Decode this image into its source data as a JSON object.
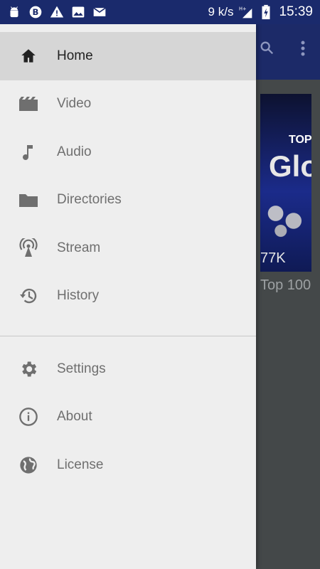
{
  "statusbar": {
    "speed": "9 k/s",
    "network": "H+",
    "time": "15:39"
  },
  "background": {
    "card_banner_small": "TOP",
    "card_banner_big": "Glo",
    "card_views": "77K",
    "card_title": "Top 100"
  },
  "drawer": {
    "items": [
      {
        "label": "Home",
        "icon": "home-icon",
        "selected": true
      },
      {
        "label": "Video",
        "icon": "movie-icon"
      },
      {
        "label": "Audio",
        "icon": "music-note-icon"
      },
      {
        "label": "Directories",
        "icon": "folder-icon"
      },
      {
        "label": "Stream",
        "icon": "stream-antenna-icon"
      },
      {
        "label": "History",
        "icon": "history-icon"
      }
    ],
    "secondary": [
      {
        "label": "Settings",
        "icon": "gear-icon"
      },
      {
        "label": "About",
        "icon": "info-icon"
      },
      {
        "label": "License",
        "icon": "globe-icon"
      }
    ]
  },
  "colors": {
    "statusbar": "#1a2a6c",
    "drawer_bg": "#eeeeee",
    "selected_bg": "#d6d6d6",
    "icon_gray": "#6f6f6f"
  }
}
